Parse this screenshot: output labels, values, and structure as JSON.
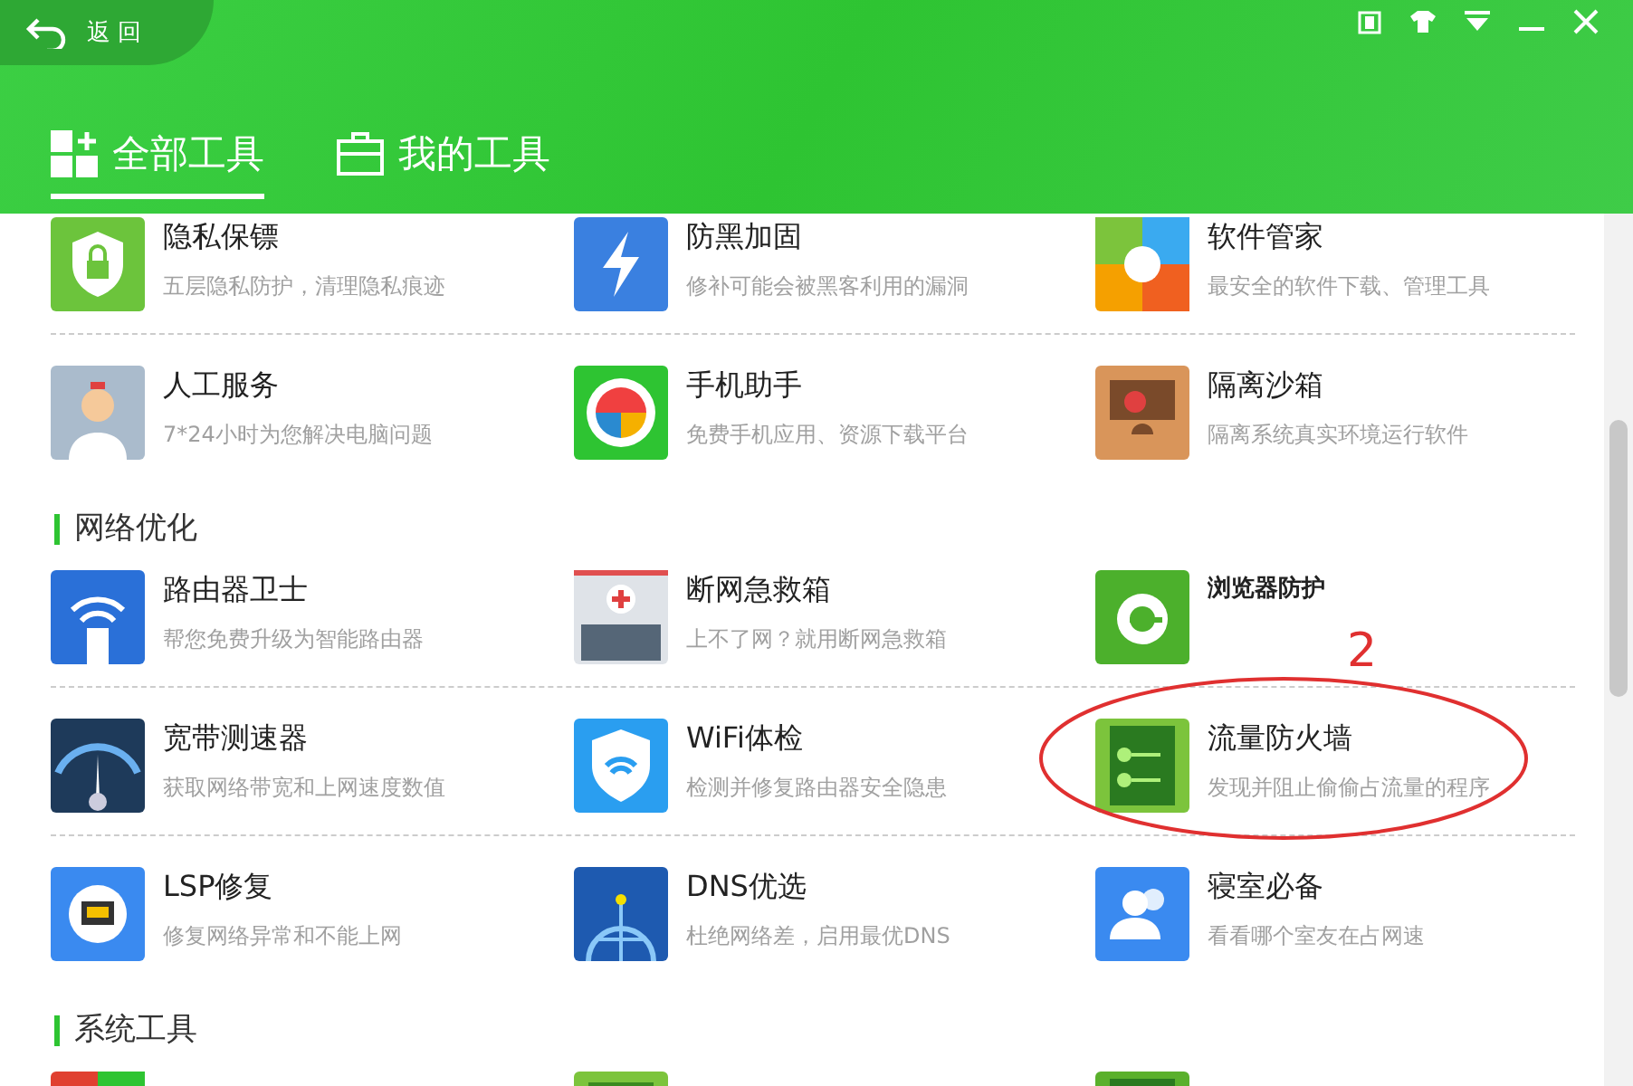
{
  "header": {
    "back_label": "返 回"
  },
  "tabs": [
    {
      "label": "全部工具",
      "selected": true
    },
    {
      "label": "我的工具",
      "selected": false
    }
  ],
  "sections": [
    {
      "rows": [
        [
          {
            "name": "隐私保镖",
            "desc": "五层隐私防护，清理隐私痕迹"
          },
          {
            "name": "防黑加固",
            "desc": "修补可能会被黑客利用的漏洞"
          },
          {
            "name": "软件管家",
            "desc": "最安全的软件下载、管理工具"
          }
        ],
        [
          {
            "name": "人工服务",
            "desc": "7*24小时为您解决电脑问题"
          },
          {
            "name": "手机助手",
            "desc": "免费手机应用、资源下载平台"
          },
          {
            "name": "隔离沙箱",
            "desc": "隔离系统真实环境运行软件"
          }
        ]
      ]
    },
    {
      "title": "网络优化",
      "rows": [
        [
          {
            "name": "路由器卫士",
            "desc": "帮您免费升级为智能路由器"
          },
          {
            "name": "断网急救箱",
            "desc": "上不了网？就用断网急救箱"
          },
          {
            "name": "浏览器防护"
          }
        ],
        [
          {
            "name": "宽带测速器",
            "desc": "获取网络带宽和上网速度数值"
          },
          {
            "name": "WiFi体检",
            "desc": "检测并修复路由器安全隐患"
          },
          {
            "name": "流量防火墙",
            "desc": "发现并阻止偷偷占流量的程序"
          }
        ],
        [
          {
            "name": "LSP修复",
            "desc": "修复网络异常和不能上网"
          },
          {
            "name": "DNS优选",
            "desc": "杜绝网络差，启用最优DNS"
          },
          {
            "name": "寝室必备",
            "desc": "看看哪个室友在占网速"
          }
        ]
      ]
    },
    {
      "title": "系统工具",
      "rows": [
        [
          {},
          {},
          {}
        ]
      ]
    }
  ],
  "annotation": {
    "label": "2"
  }
}
